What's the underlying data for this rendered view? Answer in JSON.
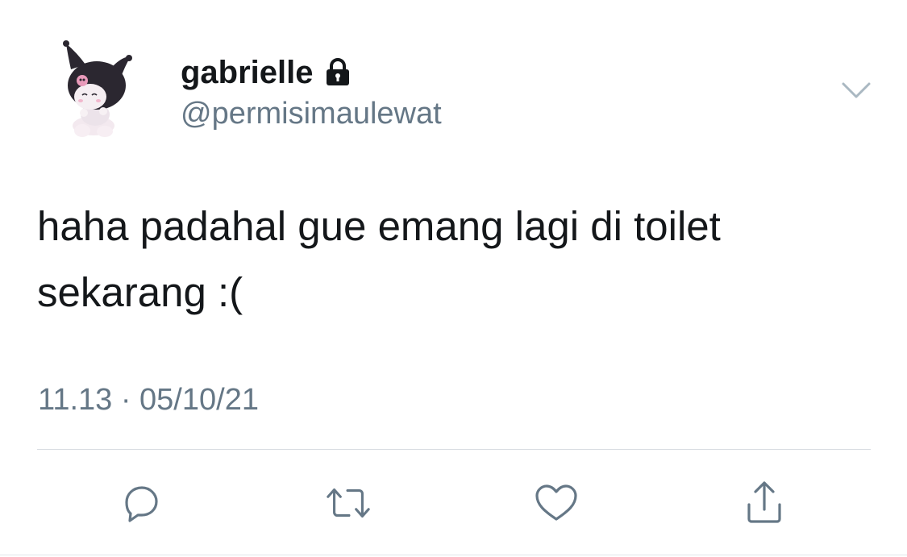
{
  "tweet": {
    "user": {
      "display_name": "gabrielle",
      "handle": "@permisimaulewat",
      "protected": true,
      "avatar": "kuromi-avatar"
    },
    "text": "haha padahal gue emang lagi di toilet sekarang :(",
    "timestamp": "11.13 · 05/10/21"
  },
  "actions": [
    {
      "name": "reply",
      "icon": "speech-bubble-icon"
    },
    {
      "name": "retweet",
      "icon": "retweet-arrows-icon"
    },
    {
      "name": "like",
      "icon": "heart-icon"
    },
    {
      "name": "share",
      "icon": "upload-share-icon"
    }
  ],
  "colors": {
    "text_primary": "#14171a",
    "text_secondary": "#657786",
    "icon": "#657786",
    "divider": "#d8dde2",
    "background": "#ffffff"
  }
}
